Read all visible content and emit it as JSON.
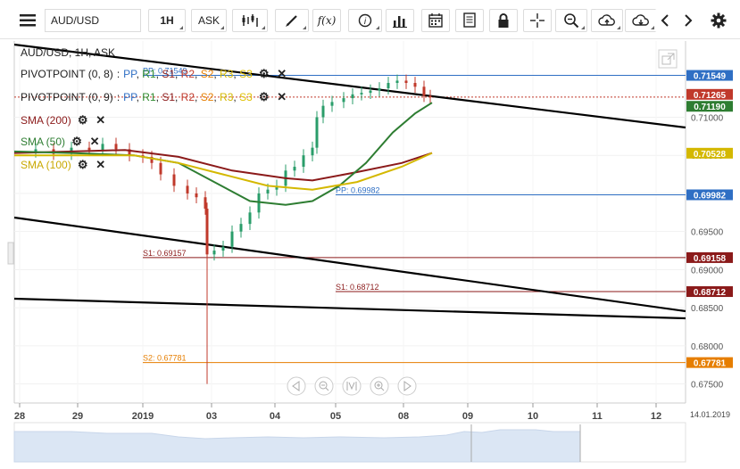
{
  "toolbar": {
    "menu_icon": "hamburger-icon",
    "symbol": "AUD/USD",
    "timeframe": "1H",
    "price_side": "ASK",
    "chart_type_icon": "candlestick-icon",
    "draw_icon": "pen-icon",
    "function_label": "f(x)",
    "buttons": [
      "info-icon",
      "bar-chart-icon",
      "calendar-icon",
      "document-icon",
      "lock-icon",
      "crosshair-icon",
      "zoom-icon",
      "cloud-upload-icon",
      "cloud-download-icon",
      "chevron-left-icon",
      "chevron-right-icon",
      "gear-icon"
    ]
  },
  "header": {
    "title": "AUD/USD, 1H, ASK",
    "indicators": [
      {
        "label": "PIVOTPOINT (0, 8)",
        "levels": [
          "PP",
          "R1",
          "S1",
          "R2",
          "S2",
          "R3",
          "S3"
        ]
      },
      {
        "label": "PIVOTPOINT (0, 9)",
        "levels": [
          "PP",
          "R1",
          "S1",
          "R2",
          "S2",
          "R3",
          "S3"
        ]
      },
      {
        "label": "SMA (200)",
        "color": "#8b1a1a"
      },
      {
        "label": "SMA (50)",
        "color": "#2e7d32"
      },
      {
        "label": "SMA (100)",
        "color": "#d4b800"
      }
    ]
  },
  "level_colors": {
    "PP": "#2f6fc4",
    "R1": "#2e8b2e",
    "S1": "#8b1a1a",
    "R2": "#c0392b",
    "S2": "#e67e00",
    "R3": "#d4b800",
    "S3": "#e0c000"
  },
  "chart_data": {
    "type": "line",
    "title": "AUD/USD, 1H, ASK",
    "ylim": [
      0.6725,
      0.72
    ],
    "y_ticks": [
      "0.71000",
      "0.70500",
      "0.70000",
      "0.69500",
      "0.69000",
      "0.68500",
      "0.68000",
      "0.67500"
    ],
    "x_ticks": [
      "28",
      "29",
      "2019",
      "03",
      "04",
      "05",
      "08",
      "09",
      "10",
      "11",
      "12"
    ],
    "x_end_label": "14.01.2019",
    "current_price": "0.71265",
    "price_badges": [
      {
        "value": "0.71549",
        "color": "#2f6fc4"
      },
      {
        "value": "0.71265",
        "color": "#c0392b"
      },
      {
        "value": "0.71190",
        "color": "#2e7d32"
      },
      {
        "value": "0.70528",
        "color": "#d4b800"
      },
      {
        "value": "0.69982",
        "color": "#2f6fc4"
      },
      {
        "value": "0.69158",
        "color": "#8b1a1a"
      },
      {
        "value": "0.68712",
        "color": "#8b1a1a"
      },
      {
        "value": "0.67781",
        "color": "#e67e00"
      }
    ],
    "level_labels": [
      {
        "text": "PP: 0.71549",
        "value": 0.71549,
        "color": "#2f6fc4"
      },
      {
        "text": "PP: 0.69982",
        "value": 0.69982,
        "color": "#2f6fc4"
      },
      {
        "text": "S1: 0.69157",
        "value": 0.69158,
        "color": "#8b1a1a"
      },
      {
        "text": "S1: 0.68712",
        "value": 0.68712,
        "color": "#8b1a1a"
      },
      {
        "text": "S2: 0.67781",
        "value": 0.67781,
        "color": "#e67e00"
      }
    ],
    "series": [
      {
        "name": "SMA (200)",
        "color": "#8b1a1a"
      },
      {
        "name": "SMA (50)",
        "color": "#2e7d32"
      },
      {
        "name": "SMA (100)",
        "color": "#d4b800"
      }
    ]
  },
  "nav_controls": [
    "nav-left-icon",
    "zoom-out-icon",
    "reset-icon",
    "zoom-in-icon",
    "nav-right-icon"
  ]
}
